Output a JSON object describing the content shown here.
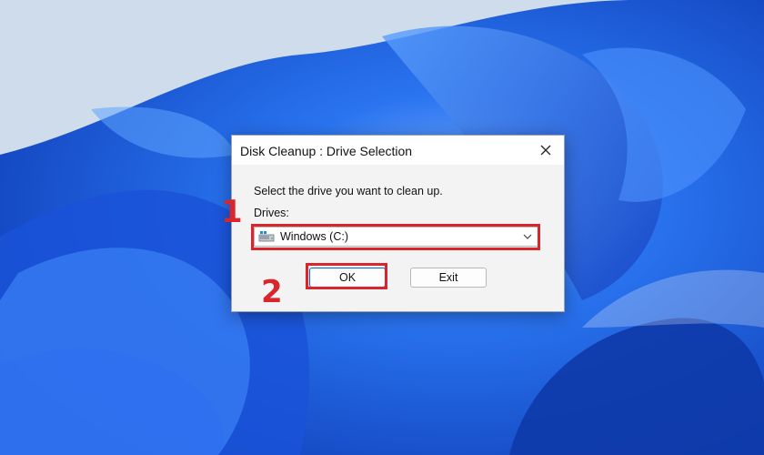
{
  "dialog": {
    "title": "Disk Cleanup : Drive Selection",
    "prompt": "Select the drive you want to clean up.",
    "drives_label": "Drives:",
    "selected_drive": "Windows (C:)",
    "ok_label": "OK",
    "exit_label": "Exit"
  },
  "annotations": {
    "step1": "1",
    "step2": "2"
  },
  "icons": [
    "close-icon",
    "drive-icon",
    "chevron-down-icon"
  ],
  "colors": {
    "highlight": "#d9262d",
    "wallpaper_blue": "#1f5fe0",
    "background": "#c9d9ec"
  }
}
